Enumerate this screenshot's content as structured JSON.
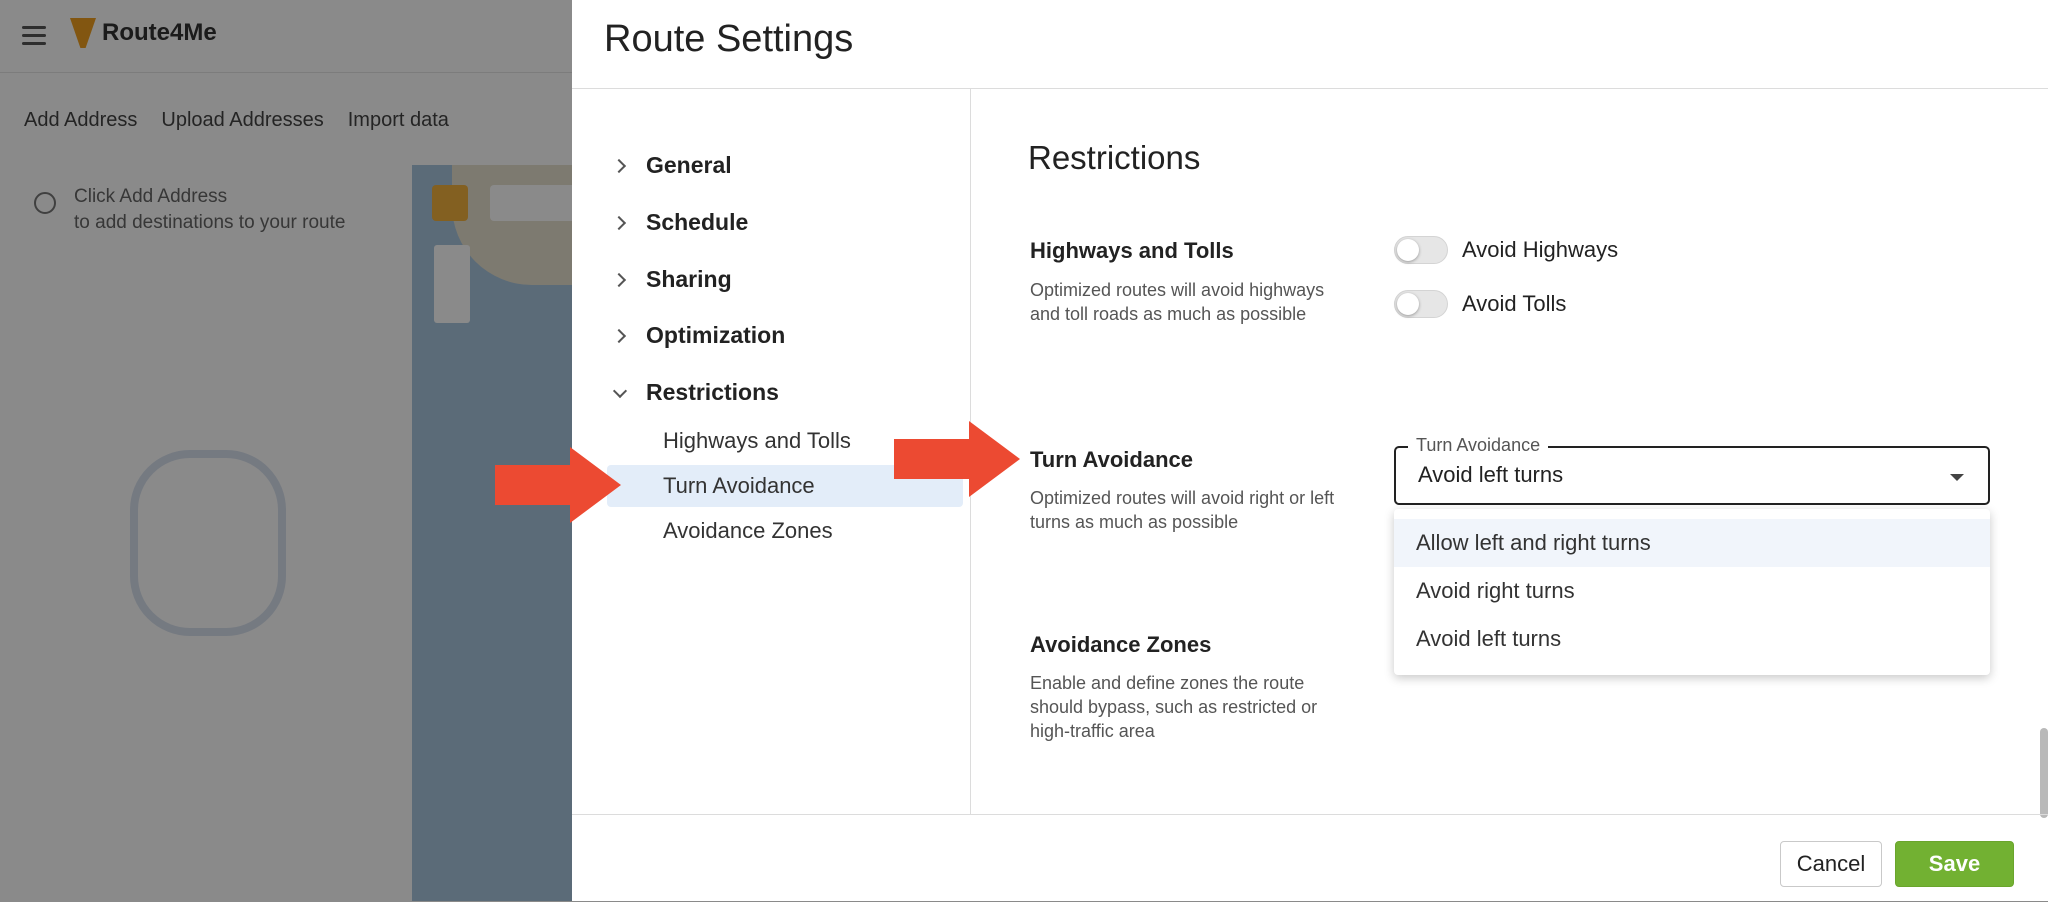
{
  "background_app": {
    "logo_text": "Route4Me",
    "toolbar": [
      "Add Address",
      "Upload Addresses",
      "Import data"
    ],
    "hint_line1": "Click Add Address",
    "hint_line2": "to add destinations to your route"
  },
  "dialog": {
    "title": "Route Settings",
    "nav": {
      "items": [
        {
          "label": "General",
          "expanded": false
        },
        {
          "label": "Schedule",
          "expanded": false
        },
        {
          "label": "Sharing",
          "expanded": false
        },
        {
          "label": "Optimization",
          "expanded": false
        },
        {
          "label": "Restrictions",
          "expanded": true
        }
      ],
      "sub_items": [
        {
          "label": "Highways and Tolls",
          "active": false
        },
        {
          "label": "Turn Avoidance",
          "active": true
        },
        {
          "label": "Avoidance Zones",
          "active": false
        }
      ]
    },
    "section": {
      "title": "Restrictions",
      "highways": {
        "label": "Highways and Tolls",
        "description": "Optimized routes will avoid highways and toll roads as much as possible",
        "toggles": [
          {
            "label": "Avoid Highways",
            "on": false
          },
          {
            "label": "Avoid Tolls",
            "on": false
          }
        ]
      },
      "turn": {
        "label": "Turn Avoidance",
        "description": "Optimized routes will avoid right or left turns as much as possible",
        "select_legend": "Turn Avoidance",
        "select_value": "Avoid left turns",
        "options": [
          "Allow left and right turns",
          "Avoid right turns",
          "Avoid left turns"
        ],
        "highlighted_option": "Allow left and right turns"
      },
      "zones": {
        "label": "Avoidance Zones",
        "description": "Enable and define zones the route should bypass, such as restricted or high-traffic area"
      }
    },
    "footer": {
      "cancel_label": "Cancel",
      "save_label": "Save"
    }
  },
  "colors": {
    "save_button": "#72b132",
    "active_nav_bg": "#e3edf9",
    "callout_arrow": "#ec4a32"
  }
}
